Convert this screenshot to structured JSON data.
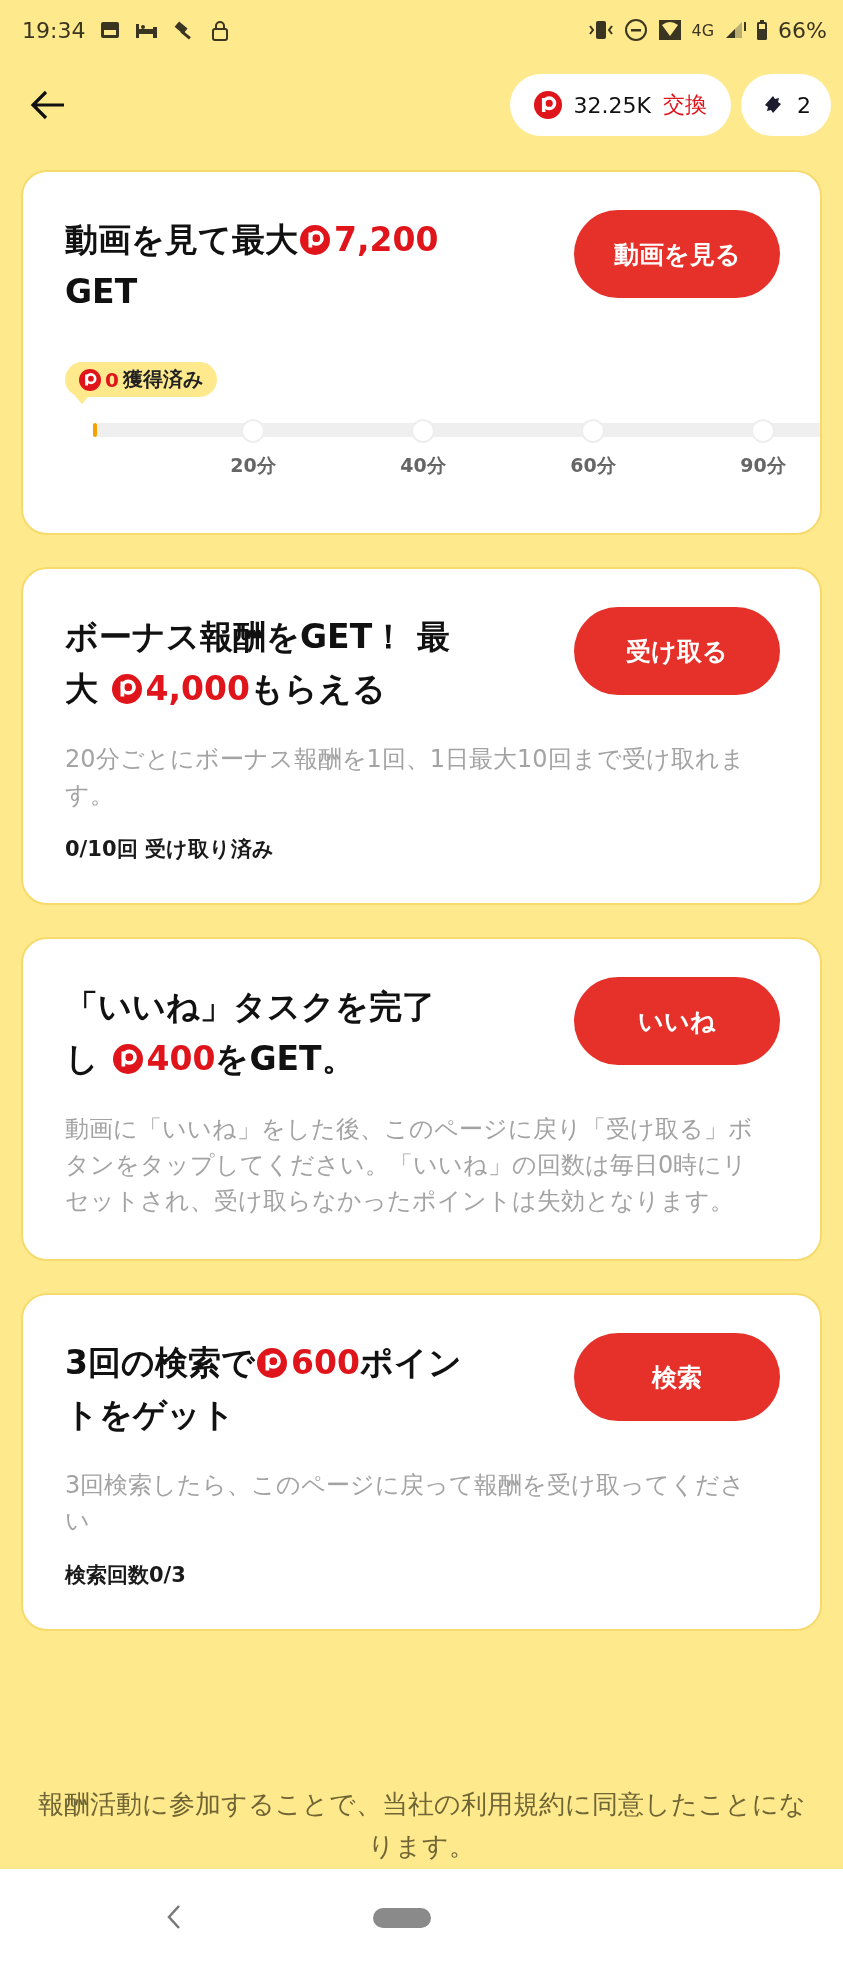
{
  "status_bar": {
    "time": "19:34",
    "network": "4G",
    "battery": "66%"
  },
  "header": {
    "points": "32.25K",
    "exchange": "交換",
    "tickets": "2"
  },
  "cards": [
    {
      "kind": "progress",
      "title_lines": [
        [
          {
            "kind": "text",
            "text": "動画を見て最大"
          },
          {
            "kind": "points",
            "text": "7,200"
          }
        ],
        [
          {
            "kind": "text",
            "text": "GET"
          }
        ]
      ],
      "button": "動画を見る",
      "earned": {
        "amount": "0",
        "label": "獲得済み"
      },
      "progress": {
        "level": 0.006,
        "milestones": [
          "20分",
          "40分",
          "60分",
          "90分"
        ]
      }
    },
    {
      "kind": "info",
      "title_lines": [
        [
          {
            "kind": "text",
            "text": "ボーナス報酬をGET！ 最"
          }
        ],
        [
          {
            "kind": "text",
            "text": "大 "
          },
          {
            "kind": "points",
            "text": "4,000"
          },
          {
            "kind": "text",
            "text": "もらえる"
          }
        ]
      ],
      "button": "受け取る",
      "description": "20分ごとにボーナス報酬を1回、1日最大10回まで受け取れます。",
      "status": "0/10回 受け取り済み"
    },
    {
      "kind": "info",
      "title_lines": [
        [
          {
            "kind": "text",
            "text": "「いいね」タスクを完了"
          }
        ],
        [
          {
            "kind": "text",
            "text": "し "
          },
          {
            "kind": "points",
            "text": "400"
          },
          {
            "kind": "text",
            "text": "をGET。"
          }
        ]
      ],
      "button": "いいね",
      "description": "動画に「いいね」をした後、このページに戻り「受け取る」ボタンをタップしてください。「いいね」の回数は毎日0時にリセットされ、受け取らなかったポイントは失効となります。"
    },
    {
      "kind": "info",
      "title_lines": [
        [
          {
            "kind": "text",
            "text": "3回の検索で"
          },
          {
            "kind": "points",
            "text": "600"
          },
          {
            "kind": "text",
            "text": "ポイン"
          }
        ],
        [
          {
            "kind": "text",
            "text": "トをゲット"
          }
        ]
      ],
      "button": "検索",
      "description": "3回検索したら、このページに戻って報酬を受け取ってください",
      "status": "検索回数0/3"
    }
  ],
  "footer": "報酬活動に参加することで、当社の利用規約に同意したことになります。"
}
